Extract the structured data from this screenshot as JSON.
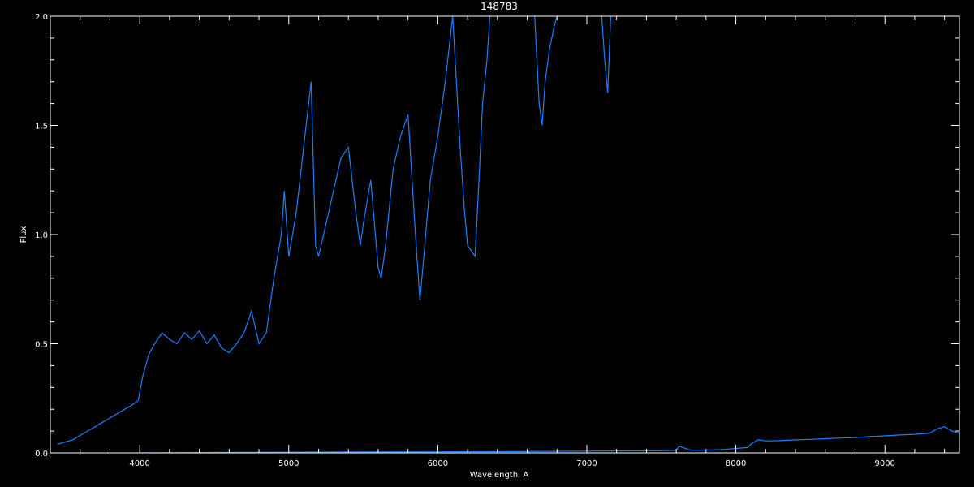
{
  "chart_data": {
    "type": "line",
    "title": "148783",
    "xlabel": "Wavelength, A",
    "ylabel": "Flux",
    "xlim": [
      3400,
      9500
    ],
    "ylim": [
      0.0,
      2.0
    ],
    "grid": false,
    "background": "#000000",
    "axis_color": "#ffffff",
    "x_ticks": [
      {
        "value": 4000,
        "label": "4000"
      },
      {
        "value": 5000,
        "label": "5000"
      },
      {
        "value": 6000,
        "label": "6000"
      },
      {
        "value": 7000,
        "label": "7000"
      },
      {
        "value": 8000,
        "label": "8000"
      },
      {
        "value": 9000,
        "label": "9000"
      }
    ],
    "y_ticks": [
      {
        "value": 0.0,
        "label": "0.0"
      },
      {
        "value": 0.5,
        "label": "0.5"
      },
      {
        "value": 1.0,
        "label": "1.0"
      },
      {
        "value": 1.5,
        "label": "1.5"
      },
      {
        "value": 2.0,
        "label": "2.0"
      }
    ],
    "series": [
      {
        "color": "#1a7fff",
        "x": [
          3450,
          3500,
          3550,
          3600,
          3650,
          3700,
          3750,
          3800,
          3850,
          3900,
          3950,
          3990,
          4020,
          4060,
          4100,
          4150,
          4200,
          4250,
          4300,
          4350,
          4400,
          4450,
          4500,
          4550,
          4600,
          4650,
          4700,
          4750,
          4800,
          4850,
          4900,
          4950,
          4970,
          5000,
          5050,
          5100,
          5150,
          5180,
          5200,
          5250,
          5300,
          5350,
          5400,
          5450,
          5480,
          5500,
          5550,
          5600,
          5620,
          5650,
          5700,
          5750,
          5800,
          5850,
          5880,
          5900,
          5950,
          6000,
          6050,
          6100,
          6150,
          6180,
          6200,
          6250,
          6280,
          6300,
          6330,
          6350,
          6360
        ],
        "y": [
          0.04,
          0.05,
          0.06,
          0.08,
          0.1,
          0.12,
          0.14,
          0.16,
          0.18,
          0.2,
          0.22,
          0.24,
          0.35,
          0.45,
          0.5,
          0.55,
          0.52,
          0.5,
          0.55,
          0.52,
          0.56,
          0.5,
          0.54,
          0.48,
          0.46,
          0.5,
          0.55,
          0.65,
          0.5,
          0.55,
          0.8,
          1.0,
          1.2,
          0.9,
          1.1,
          1.4,
          1.7,
          0.95,
          0.9,
          1.05,
          1.2,
          1.35,
          1.4,
          1.1,
          0.95,
          1.05,
          1.25,
          0.85,
          0.8,
          0.95,
          1.3,
          1.45,
          1.55,
          1.0,
          0.7,
          0.85,
          1.25,
          1.45,
          1.7,
          2.0,
          1.4,
          1.1,
          0.95,
          0.9,
          1.3,
          1.6,
          1.8,
          2.0,
          2.0
        ]
      },
      {
        "color": "#1a7fff",
        "x": [
          6650,
          6680,
          6700,
          6720,
          6750,
          6780,
          6800
        ],
        "y": [
          2.0,
          1.6,
          1.5,
          1.7,
          1.85,
          1.95,
          2.0
        ]
      },
      {
        "color": "#1a7fff",
        "x": [
          7100,
          7120,
          7140,
          7160
        ],
        "y": [
          2.0,
          1.8,
          1.65,
          2.0
        ]
      },
      {
        "color": "#1a7fff",
        "x": [
          4000,
          4500,
          5000,
          5500,
          6000,
          6500,
          7000,
          7500,
          7600,
          7620,
          7700,
          7800,
          7900,
          8000,
          8080,
          8100,
          8150,
          8200,
          8300,
          8400,
          8500,
          8600,
          8700,
          8800,
          8900,
          9000,
          9100,
          9200,
          9300,
          9350,
          9400,
          9450,
          9500
        ],
        "y": [
          0.0,
          0.002,
          0.003,
          0.004,
          0.005,
          0.006,
          0.008,
          0.01,
          0.012,
          0.03,
          0.012,
          0.013,
          0.015,
          0.02,
          0.025,
          0.04,
          0.06,
          0.055,
          0.056,
          0.06,
          0.062,
          0.065,
          0.068,
          0.07,
          0.075,
          0.078,
          0.082,
          0.085,
          0.09,
          0.11,
          0.12,
          0.1,
          0.09
        ]
      }
    ]
  }
}
